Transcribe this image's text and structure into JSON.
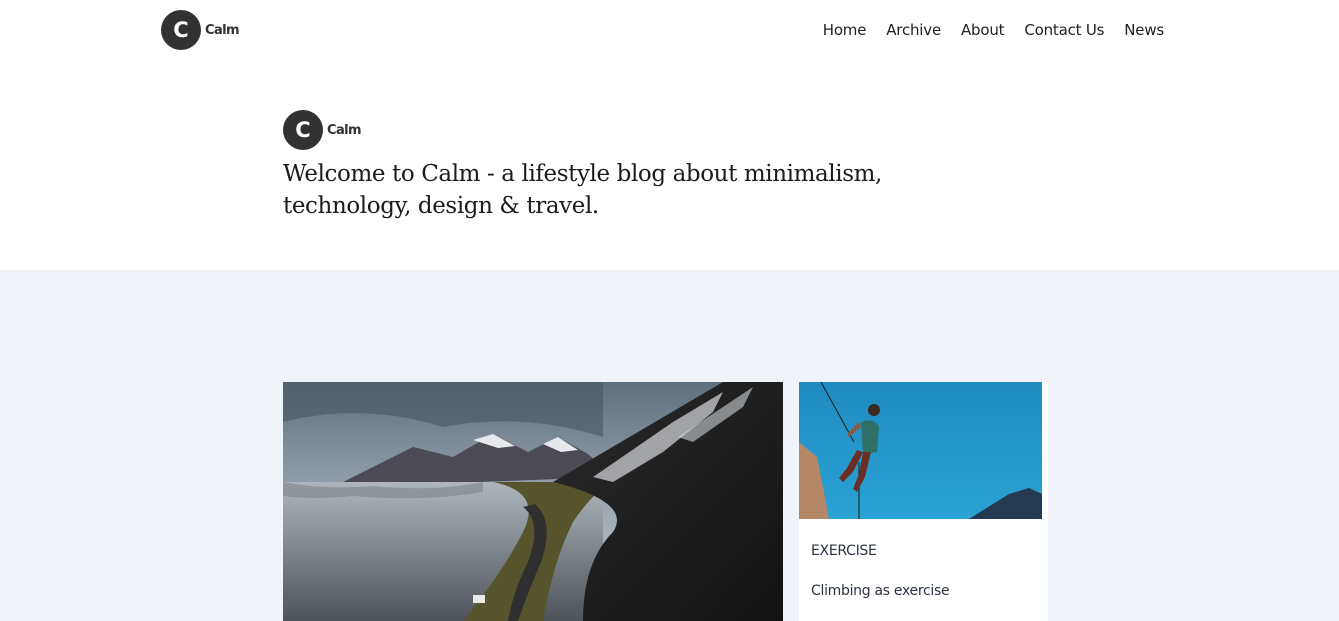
{
  "brand": {
    "initial": "C",
    "name": "Calm"
  },
  "nav": {
    "items": [
      {
        "label": "Home"
      },
      {
        "label": "Archive"
      },
      {
        "label": "About"
      },
      {
        "label": "Contact Us"
      },
      {
        "label": "News"
      }
    ]
  },
  "hero": {
    "initial": "C",
    "name": "Calm",
    "tagline": "Welcome to Calm - a lifestyle blog about minimalism, technology, design & travel."
  },
  "posts": {
    "featured": {
      "image": "mountain-road-landscape"
    },
    "side": {
      "image": "rock-climber",
      "category": "EXERCISE",
      "title": "Climbing as exercise"
    }
  },
  "colors": {
    "logo": "#323232",
    "section_bg": "#f0f3f8",
    "text": "#222222"
  }
}
